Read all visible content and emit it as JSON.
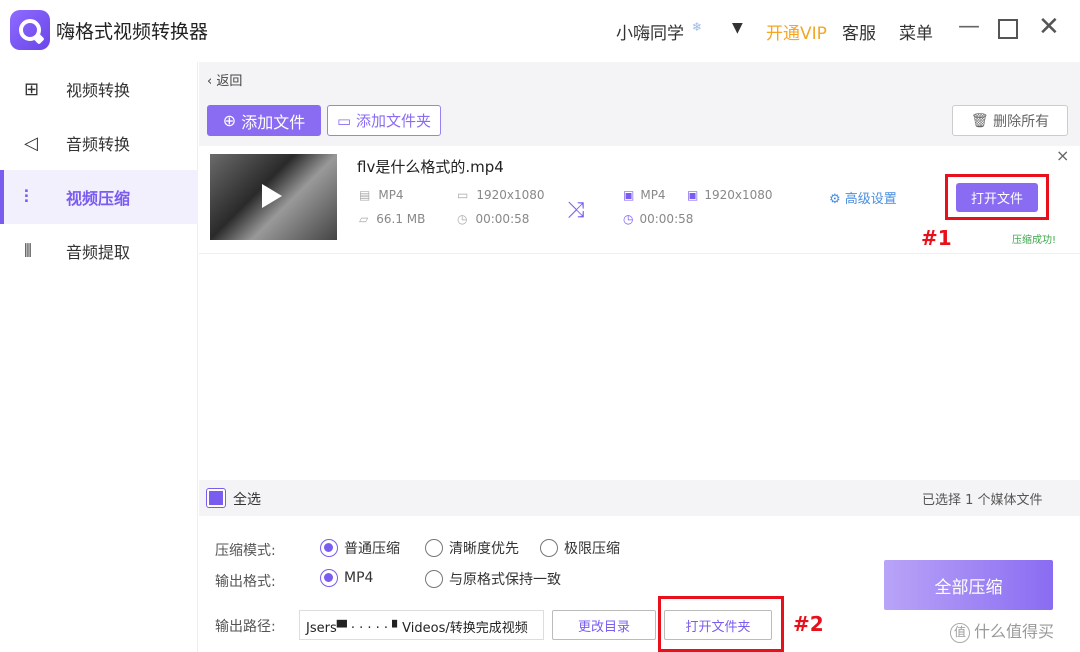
{
  "titlebar": {
    "app_title": "嗨格式视频转换器",
    "user_name": "小嗨同学",
    "user_badge": "❄",
    "user_caret": "▼",
    "vip_label": "开通VIP",
    "service_label": "客服",
    "menu_label": "菜单",
    "minimize_glyph": "—",
    "close_glyph": "✕"
  },
  "sidebar": {
    "items": [
      {
        "label": "视频转换",
        "icon": "video-convert-icon",
        "glyph": "⊞"
      },
      {
        "label": "音频转换",
        "icon": "audio-convert-icon",
        "glyph": "◁"
      },
      {
        "label": "视频压缩",
        "icon": "video-compress-icon",
        "glyph": "⫶",
        "active": true
      },
      {
        "label": "音频提取",
        "icon": "audio-extract-icon",
        "glyph": "⦀"
      }
    ]
  },
  "toolbar": {
    "back_label": "返回",
    "add_file_label": "添加文件",
    "add_folder_label": "添加文件夹",
    "delete_all_label": "删除所有"
  },
  "file": {
    "name": "flv是什么格式的.mp4",
    "src_format": "MP4",
    "src_resolution": "1920x1080",
    "src_size": "66.1 MB",
    "src_duration": "00:00:58",
    "out_format": "MP4",
    "out_resolution": "1920x1080",
    "out_duration": "00:00:58",
    "advanced_label": "高级设置",
    "open_file_label": "打开文件",
    "status": "压缩成功!",
    "annotation1": "#1"
  },
  "selection": {
    "select_all_label": "全选",
    "selected_count": "已选择 1 个媒体文件"
  },
  "settings": {
    "mode_label": "压缩模式:",
    "mode_options": [
      "普通压缩",
      "清晰度优先",
      "极限压缩"
    ],
    "mode_selected": "普通压缩",
    "format_label": "输出格式:",
    "format_options": [
      "MP4",
      "与原格式保持一致"
    ],
    "format_selected": "MP4",
    "path_label": "输出路径:",
    "path_value": "Jsers▀ · · · · · ▘Videos/转换完成视频",
    "change_dir_label": "更改目录",
    "open_folder_label": "打开文件夹",
    "annotation2": "#2",
    "compress_all_label": "全部压缩"
  },
  "watermark": {
    "icon_glyph": "值",
    "text": "什么值得买"
  },
  "colors": {
    "accent": "#7b5cf0",
    "vip": "#f5a623",
    "annotation": "#e8101a",
    "success": "#3aa84a",
    "link": "#4a8fe0"
  }
}
